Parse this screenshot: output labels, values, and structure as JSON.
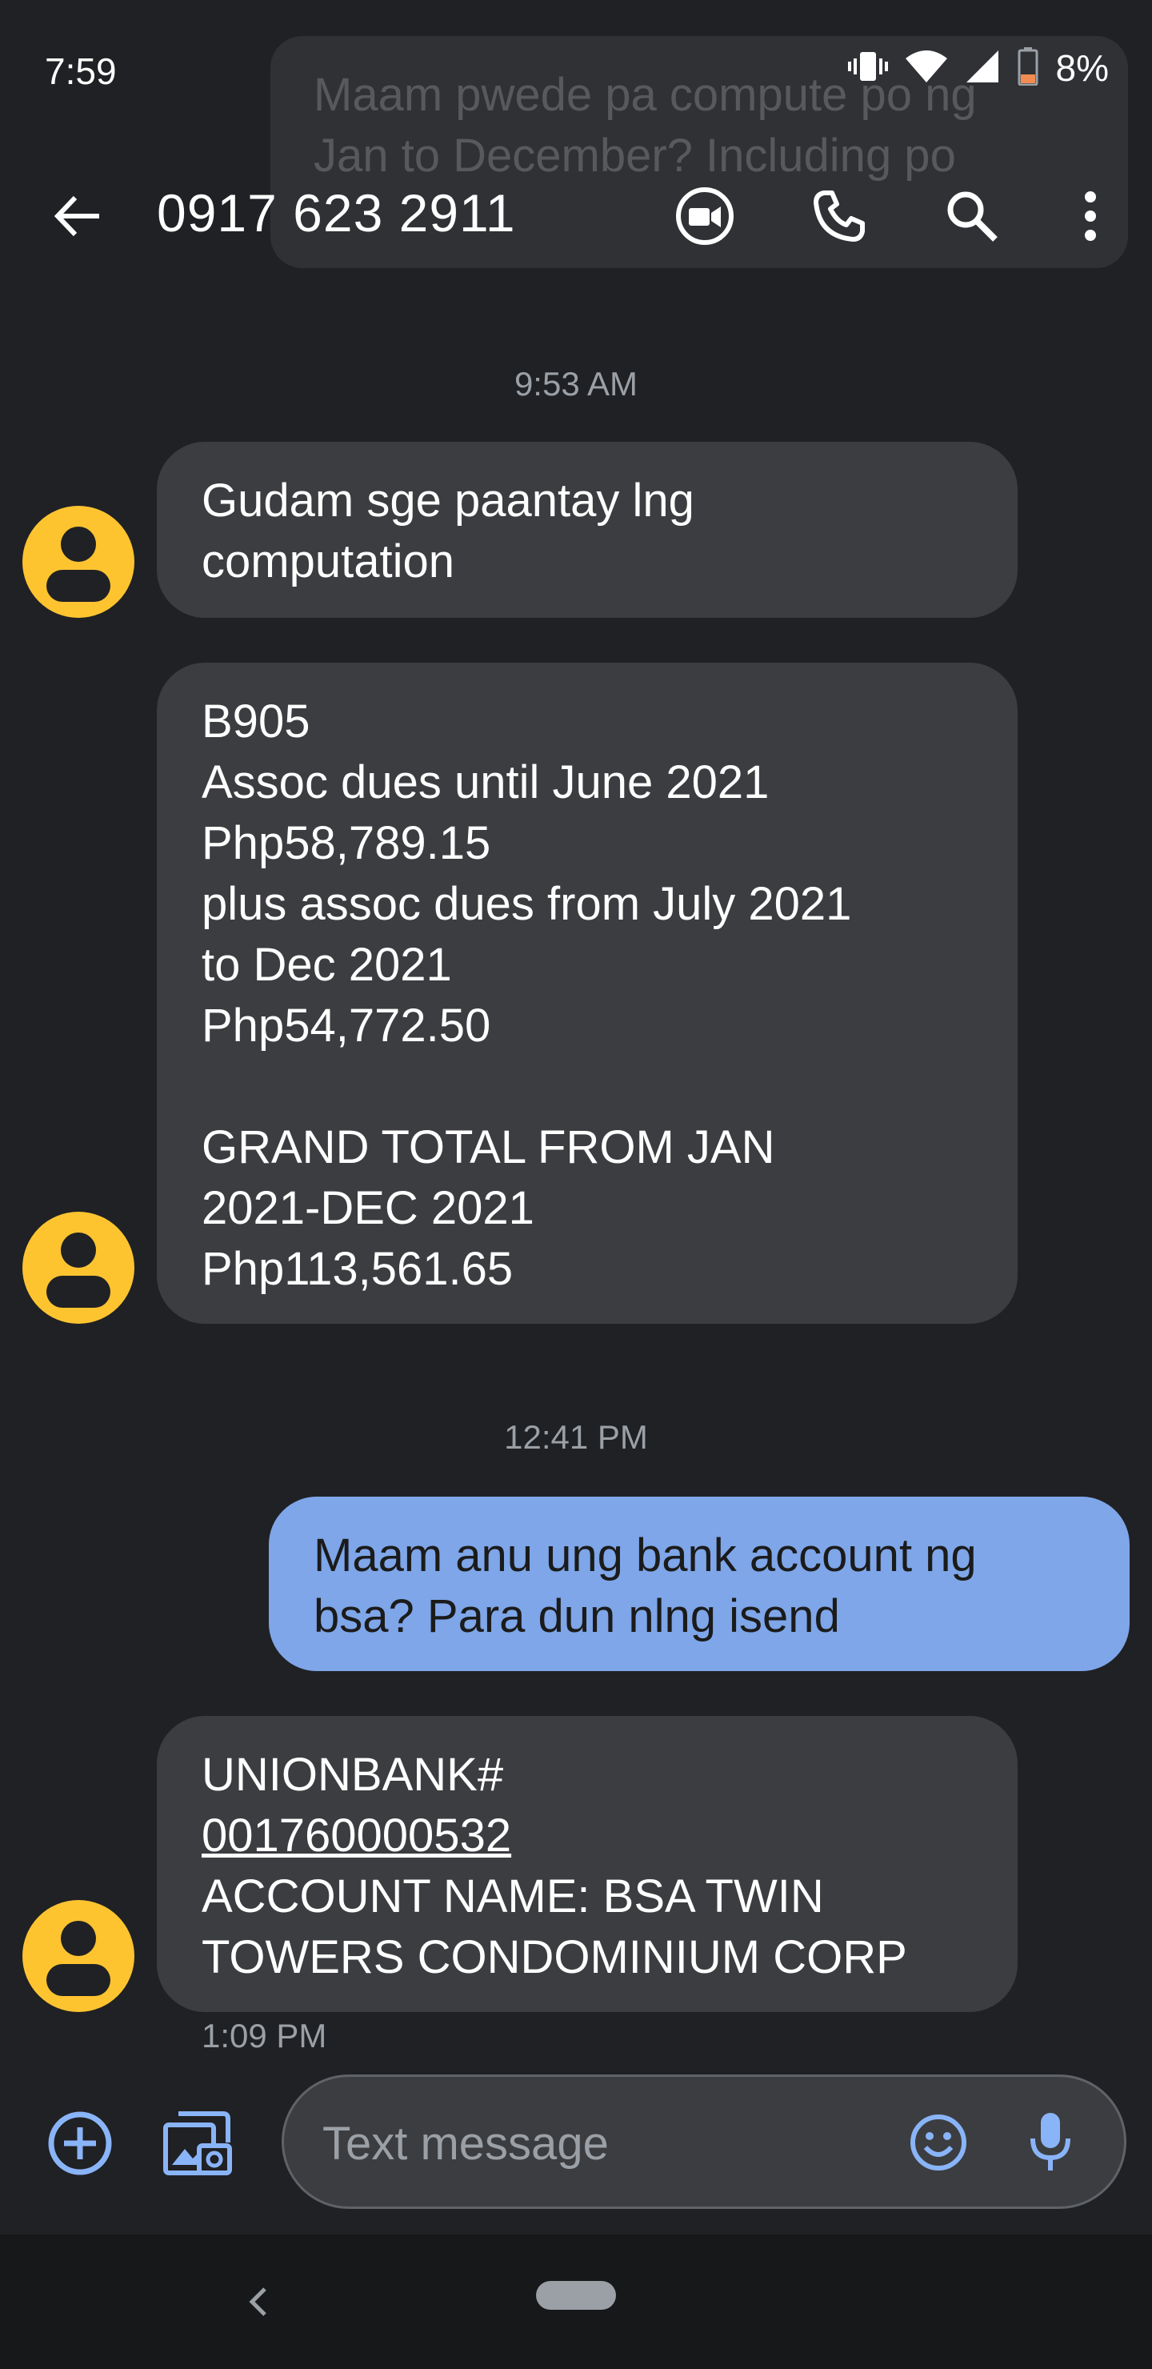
{
  "status_bar": {
    "time": "7:59",
    "battery": "8%",
    "icons": [
      "vibrate-icon",
      "wifi-icon",
      "signal-icon",
      "battery-low-icon"
    ]
  },
  "notification_preview": {
    "line1": "Maam pwede pa compute po ng",
    "line2": "Jan to December? Including po"
  },
  "app_bar": {
    "title": "0917 623 2911",
    "icons": [
      "back-arrow-icon",
      "video-call-icon",
      "phone-icon",
      "search-icon",
      "more-vert-icon"
    ]
  },
  "messages": {
    "ts1": "9:53 AM",
    "m1": {
      "line1": "Gudam sge paantay lng",
      "line2": "computation"
    },
    "m2": {
      "line1": "B905",
      "line2": "Assoc dues until June 2021",
      "line3": "Php58,789.15",
      "line4": "plus assoc dues from July 2021",
      "line5": "to Dec 2021",
      "line6": "Php54,772.50",
      "line7": "GRAND TOTAL FROM JAN",
      "line8": "2021-DEC 2021",
      "line9": "Php113,561.65"
    },
    "ts2": "12:41 PM",
    "m3": {
      "line1": "Maam anu ung bank account ng",
      "line2": "bsa? Para dun nlng isend"
    },
    "m4": {
      "line1": "UNIONBANK#",
      "line2": "001760000532",
      "line3": "ACCOUNT NAME: BSA TWIN",
      "line4": "TOWERS CONDOMINIUM CORP"
    },
    "ts3": "1:09 PM"
  },
  "compose": {
    "placeholder": "Text message",
    "icons": [
      "add-circle-icon",
      "gallery-icon",
      "emoji-icon",
      "mic-icon"
    ]
  },
  "colors": {
    "background": "#202124",
    "incoming_bubble": "#3c3d40",
    "outgoing_bubble": "#7ea6e8",
    "avatar": "#fdc430",
    "accent_icon": "#8ab4f8"
  }
}
